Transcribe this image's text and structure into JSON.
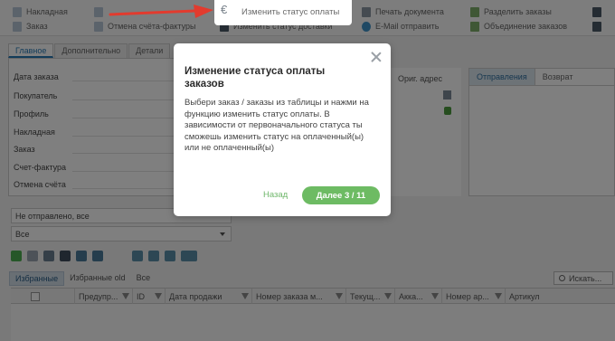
{
  "toolbar": {
    "items": [
      {
        "label": "Накладная",
        "icon": "document-icon"
      },
      {
        "label": "Заказ",
        "icon": "document-icon"
      },
      {
        "label": "Отмена счёта-фактуры",
        "icon": "document-icon"
      },
      {
        "label": "Изменить статус оплаты",
        "icon": "euro-icon"
      },
      {
        "label": "Изменить статус доставки",
        "icon": "package-icon"
      },
      {
        "label": "Печать документа",
        "icon": "printer-icon"
      },
      {
        "label": "E-Mail отправить",
        "icon": "email-icon"
      },
      {
        "label": "Разделить заказы",
        "icon": "split-icon"
      },
      {
        "label": "Объединение заказов",
        "icon": "merge-icon"
      }
    ]
  },
  "tabs": {
    "main": "Главное",
    "additional": "Дополнительно",
    "details": "Детали"
  },
  "form": {
    "fields": [
      "Дата заказа",
      "Покупатель",
      "Профиль",
      "Накладная",
      "Заказ",
      "Счет-фактура",
      "Отмена счёта"
    ]
  },
  "orig_address": "Ориг. адрес",
  "shipping_tabs": {
    "shipments": "Отправления",
    "returns": "Возврат"
  },
  "filters": {
    "status": "Не отправлено, все",
    "all": "Все"
  },
  "lower_tabs": {
    "favorites": "Избранные",
    "favorites_old": "Избранные old",
    "all": "Все"
  },
  "search": {
    "label": "Искать..."
  },
  "grid": {
    "columns": [
      "Предупр...",
      "ID",
      "Дата продажи",
      "Номер заказа м...",
      "Текущ...",
      "Акка...",
      "Номер ар...",
      "Артикул"
    ]
  },
  "popup": {
    "title": "Изменение статуса оплаты заказов",
    "body": "Выбери заказ / заказы из таблицы и нажми на функцию изменить статус оплаты. В зависимости от первоначального статуса ты сможешь изменить статус на оплаченный(ы) или не оплаченный(ы)",
    "back": "Назад",
    "next": "Далее 3 / 11"
  },
  "colors": {
    "accent_green": "#6dbb63",
    "arrow_red": "#e23b2e",
    "active_tab_blue": "#2778b5"
  }
}
